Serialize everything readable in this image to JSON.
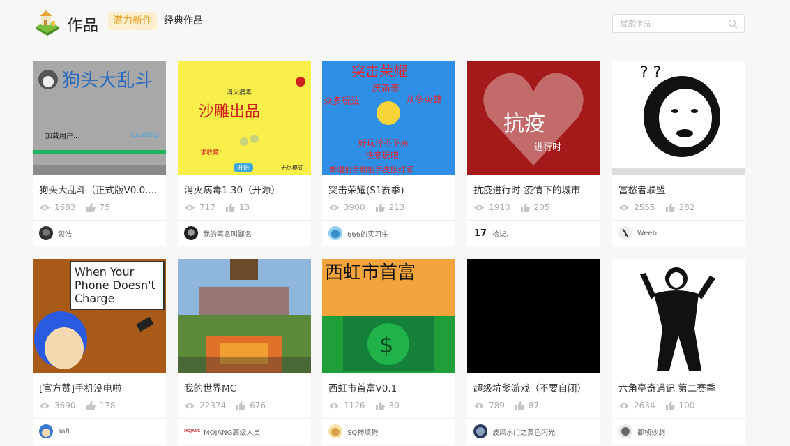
{
  "header": {
    "title": "作品",
    "tab_active": "潜力新作",
    "tab_other": "经典作品",
    "search_placeholder": "搜索作品"
  },
  "colors": {
    "accent": "#e6a12b",
    "accent_bg": "#fdf0cf",
    "card_bg": "#ffffff",
    "page_bg": "#f7f7f7"
  },
  "cards": [
    {
      "title": "狗头大乱斗（正式版V0.0....",
      "views": "1683",
      "likes": "75",
      "author": "领浩",
      "thumb_text": [
        "狗头大乱斗",
        "加载用户...",
        "Loading"
      ],
      "avatar": "dark-avatar"
    },
    {
      "title": "消灭病毒1.30（开源）",
      "views": "717",
      "likes": "13",
      "author": "我的笔名叫鄙名",
      "thumb_text": [
        "消灭病毒",
        "沙雕出品",
        "求收藏!",
        "开始",
        "无尽模式"
      ],
      "avatar": "dark-avatar"
    },
    {
      "title": "突击荣耀(S1赛季)",
      "views": "3900",
      "likes": "213",
      "author": "666的实习生",
      "thumb_text": [
        "突击荣耀",
        "庆新春",
        "众多玩法",
        "众多英雄",
        "好玩停不下来",
        "快来玩吧",
        "新增射手和射手皮肤红军"
      ],
      "avatar": "blue-avatar"
    },
    {
      "title": "抗疫进行时-疫情下的城市",
      "views": "1910",
      "likes": "205",
      "author": "拾柒、",
      "thumb_text": [
        "抗疫",
        "进行时"
      ],
      "avatar_text": "17"
    },
    {
      "title": "富愁者联盟",
      "views": "2555",
      "likes": "282",
      "author": "Weeb",
      "thumb_text": [
        "? ?"
      ],
      "avatar": "sketch-avatar"
    },
    {
      "title": "[官方赞]手机没电啦",
      "views": "3690",
      "likes": "178",
      "author": "Tafi",
      "thumb_text": [
        "When Your",
        "Phone Doesn't",
        "Charge"
      ],
      "avatar": "blue-avatar"
    },
    {
      "title": "我的世界MC",
      "views": "22374",
      "likes": "676",
      "author": "MOJANG高级人员",
      "thumb_text": [],
      "avatar_text": "MOJANG"
    },
    {
      "title": "西虹市首富V0.1",
      "views": "1126",
      "likes": "30",
      "author": "SQ神烦狗",
      "thumb_text": [
        "西虹市首富"
      ],
      "avatar": "doge-avatar"
    },
    {
      "title": "超级坑爹游戏（不要自闭）",
      "views": "789",
      "likes": "87",
      "author": "波风水门之黄色闪光",
      "thumb_text": [],
      "avatar": "dark-avatar"
    },
    {
      "title": "六角亭奇遇记 第二赛季",
      "views": "2634",
      "likes": "100",
      "author": "鄱桢纱洞",
      "thumb_text": [],
      "avatar": "sketch-avatar"
    }
  ]
}
